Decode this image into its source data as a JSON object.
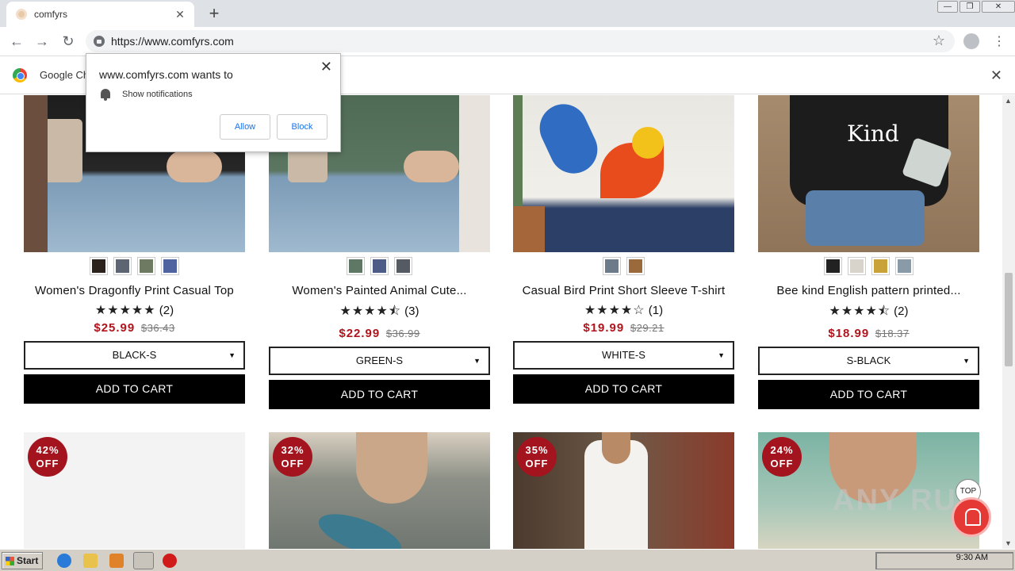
{
  "browser": {
    "tab_title": "comfyrs",
    "tab_close": "✕",
    "new_tab": "+",
    "url": "https://www.comfyrs.com",
    "infobar_text": "Google Ch",
    "infobar_close": "✕",
    "win_min": "—",
    "win_max": "❐",
    "win_close": "✕"
  },
  "notification_prompt": {
    "heading": "www.comfyrs.com wants to",
    "permission": "Show notifications",
    "allow": "Allow",
    "block": "Block",
    "close": "✕"
  },
  "products": [
    {
      "name": "Women's Dragonfly Print Casual Top",
      "stars": "★★★★★",
      "reviews": "(2)",
      "price": "$25.99",
      "old_price": "$36.43",
      "variant": "BLACK-S",
      "cart": "ADD TO CART",
      "swatch_colors": [
        "#2b211d",
        "#5d6572",
        "#6f7a63",
        "#4f63a0"
      ]
    },
    {
      "name": "Women's Painted Animal Cute...",
      "stars": "★★★★⯪",
      "reviews": "(3)",
      "price": "$22.99",
      "old_price": "$36.99",
      "variant": "GREEN-S",
      "cart": "ADD TO CART",
      "swatch_colors": [
        "#5f7866",
        "#4d5c86",
        "#555a63"
      ]
    },
    {
      "name": "Casual Bird Print Short Sleeve T-shirt",
      "stars": "★★★★☆",
      "reviews": "(1)",
      "price": "$19.99",
      "old_price": "$29.21",
      "variant": "WHITE-S",
      "cart": "ADD TO CART",
      "swatch_colors": [
        "#6c7a8a",
        "#9a6a3a"
      ]
    },
    {
      "name": "Bee kind English pattern printed...",
      "stars": "★★★★⯪",
      "reviews": "(2)",
      "price": "$18.99",
      "old_price": "$18.37",
      "variant": "S-BLACK",
      "cart": "ADD TO CART",
      "swatch_colors": [
        "#222222",
        "#d8d4cc",
        "#c9a23a",
        "#8a9aa6"
      ]
    }
  ],
  "second_row": [
    {
      "badge_pct": "42%",
      "badge_off": "OFF"
    },
    {
      "badge_pct": "32%",
      "badge_off": "OFF"
    },
    {
      "badge_pct": "35%",
      "badge_off": "OFF"
    },
    {
      "badge_pct": "24%",
      "badge_off": "OFF"
    }
  ],
  "top_button": "TOP",
  "watermark": "ANY RUN",
  "taskbar": {
    "start": "Start",
    "clock": "9:30 AM"
  }
}
